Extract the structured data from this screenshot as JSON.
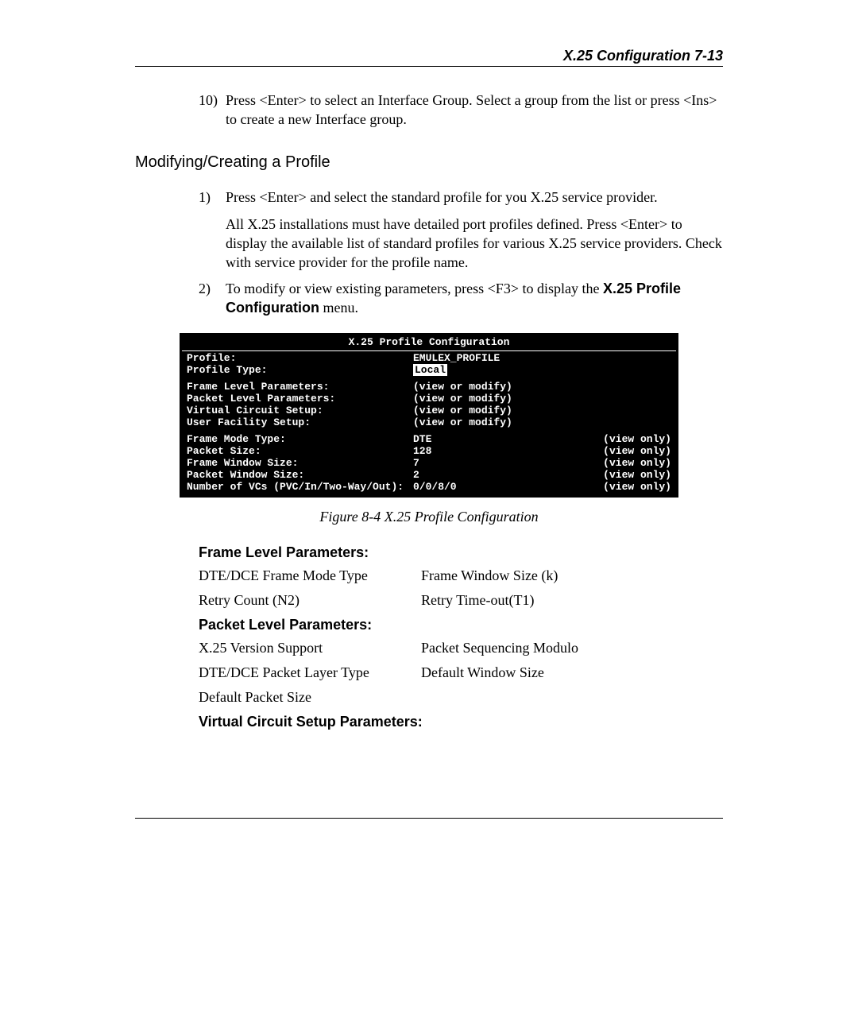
{
  "header": {
    "title": "X.25 Configuration   7-13"
  },
  "step10": {
    "num": "10)",
    "text": "Press <Enter> to select an Interface Group. Select a group from the list or press <Ins> to create a new Interface group."
  },
  "subhead": "Modifying/Creating a Profile",
  "step1": {
    "num": "1)",
    "p1": "Press <Enter> and select the standard profile for you X.25 service provider.",
    "p2": "All X.25 installations must have detailed port profiles defined. Press <Enter> to display the available list of standard profiles for various X.25 service providers.  Check with service provider for the profile name."
  },
  "step2": {
    "num": "2)",
    "pre": "To modify or view existing parameters, press <F3> to display the ",
    "bold": "X.25 Profile Configuration",
    "post": " menu."
  },
  "terminal": {
    "title": "X.25 Profile Configuration",
    "rows1": [
      {
        "label": "Profile:",
        "value": "EMULEX_PROFILE",
        "note": ""
      },
      {
        "label": "Profile Type:",
        "value": "",
        "note": "",
        "inverse": "Local"
      }
    ],
    "rows2": [
      {
        "label": "Frame Level Parameters:",
        "value": "(view or modify)",
        "note": ""
      },
      {
        "label": "Packet Level Parameters:",
        "value": "(view or modify)",
        "note": ""
      },
      {
        "label": "Virtual Circuit Setup:",
        "value": "(view or modify)",
        "note": ""
      },
      {
        "label": "User Facility Setup:",
        "value": "(view or modify)",
        "note": ""
      }
    ],
    "rows3": [
      {
        "label": "Frame Mode Type:",
        "value": "DTE",
        "note": "(view only)"
      },
      {
        "label": "Packet Size:",
        "value": "128",
        "note": "(view only)"
      },
      {
        "label": "Frame Window Size:",
        "value": "7",
        "note": "(view only)"
      },
      {
        "label": "Packet Window Size:",
        "value": "2",
        "note": "(view only)"
      },
      {
        "label": "Number of VCs (PVC/In/Two-Way/Out):",
        "value": "0/0/8/0",
        "note": "(view only)"
      }
    ]
  },
  "figure_caption": "Figure 8-4 X.25 Profile Configuration",
  "params": {
    "frame_head": "Frame Level Parameters:",
    "frame_rows": [
      {
        "l": "DTE/DCE Frame Mode Type",
        "r": "Frame Window Size (k)"
      },
      {
        "l": "Retry Count (N2)",
        "r": "Retry Time-out(T1)"
      }
    ],
    "packet_head": "Packet Level Parameters:",
    "packet_rows": [
      {
        "l": "X.25 Version Support",
        "r": "Packet Sequencing Modulo"
      },
      {
        "l": "DTE/DCE Packet Layer Type",
        "r": "Default Window Size"
      },
      {
        "l": "Default Packet Size",
        "r": ""
      }
    ],
    "vc_head": "Virtual Circuit Setup Parameters:"
  }
}
